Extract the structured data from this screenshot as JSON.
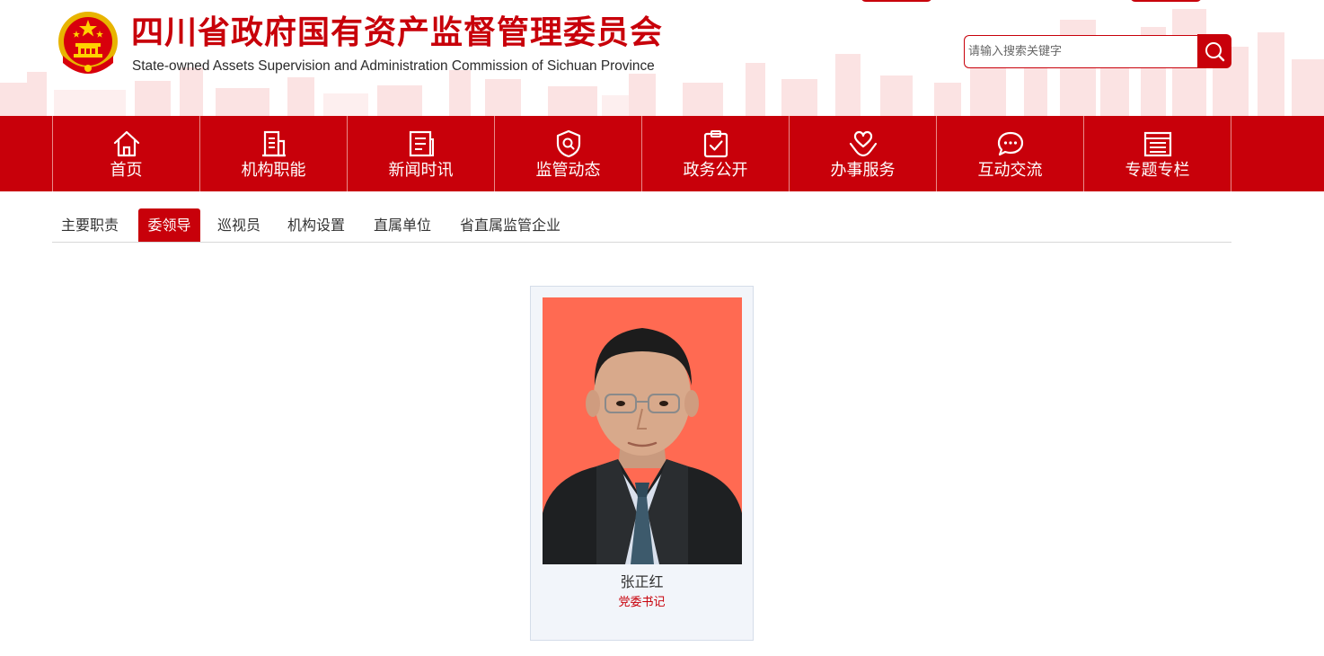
{
  "header": {
    "title_cn": "四川省政府国有资产监督管理委员会",
    "title_en": "State-owned Assets Supervision and Administration Commission of Sichuan Province",
    "emblem_icon": "national-emblem-icon"
  },
  "search": {
    "placeholder": "请输入搜索关键字",
    "value": "",
    "button_icon": "search-icon"
  },
  "nav": {
    "items": [
      {
        "label": "首页",
        "icon": "home-icon"
      },
      {
        "label": "机构职能",
        "icon": "building-icon"
      },
      {
        "label": "新闻时讯",
        "icon": "news-icon"
      },
      {
        "label": "监管动态",
        "icon": "shield-icon"
      },
      {
        "label": "政务公开",
        "icon": "clipboard-check-icon"
      },
      {
        "label": "办事服务",
        "icon": "heart-hand-icon"
      },
      {
        "label": "互动交流",
        "icon": "chat-icon"
      },
      {
        "label": "专题专栏",
        "icon": "list-icon"
      }
    ]
  },
  "subtabs": {
    "active_index": 1,
    "items": [
      {
        "label": "主要职责"
      },
      {
        "label": "委领导"
      },
      {
        "label": "巡视员"
      },
      {
        "label": "机构设置"
      },
      {
        "label": "直属单位"
      },
      {
        "label": "省直属监管企业"
      }
    ]
  },
  "leader": {
    "name": "张正红",
    "title": "党委书记"
  },
  "colors": {
    "brand_red": "#c8000a",
    "photo_background": "#ff6a52",
    "card_background": "#f2f5fa"
  }
}
